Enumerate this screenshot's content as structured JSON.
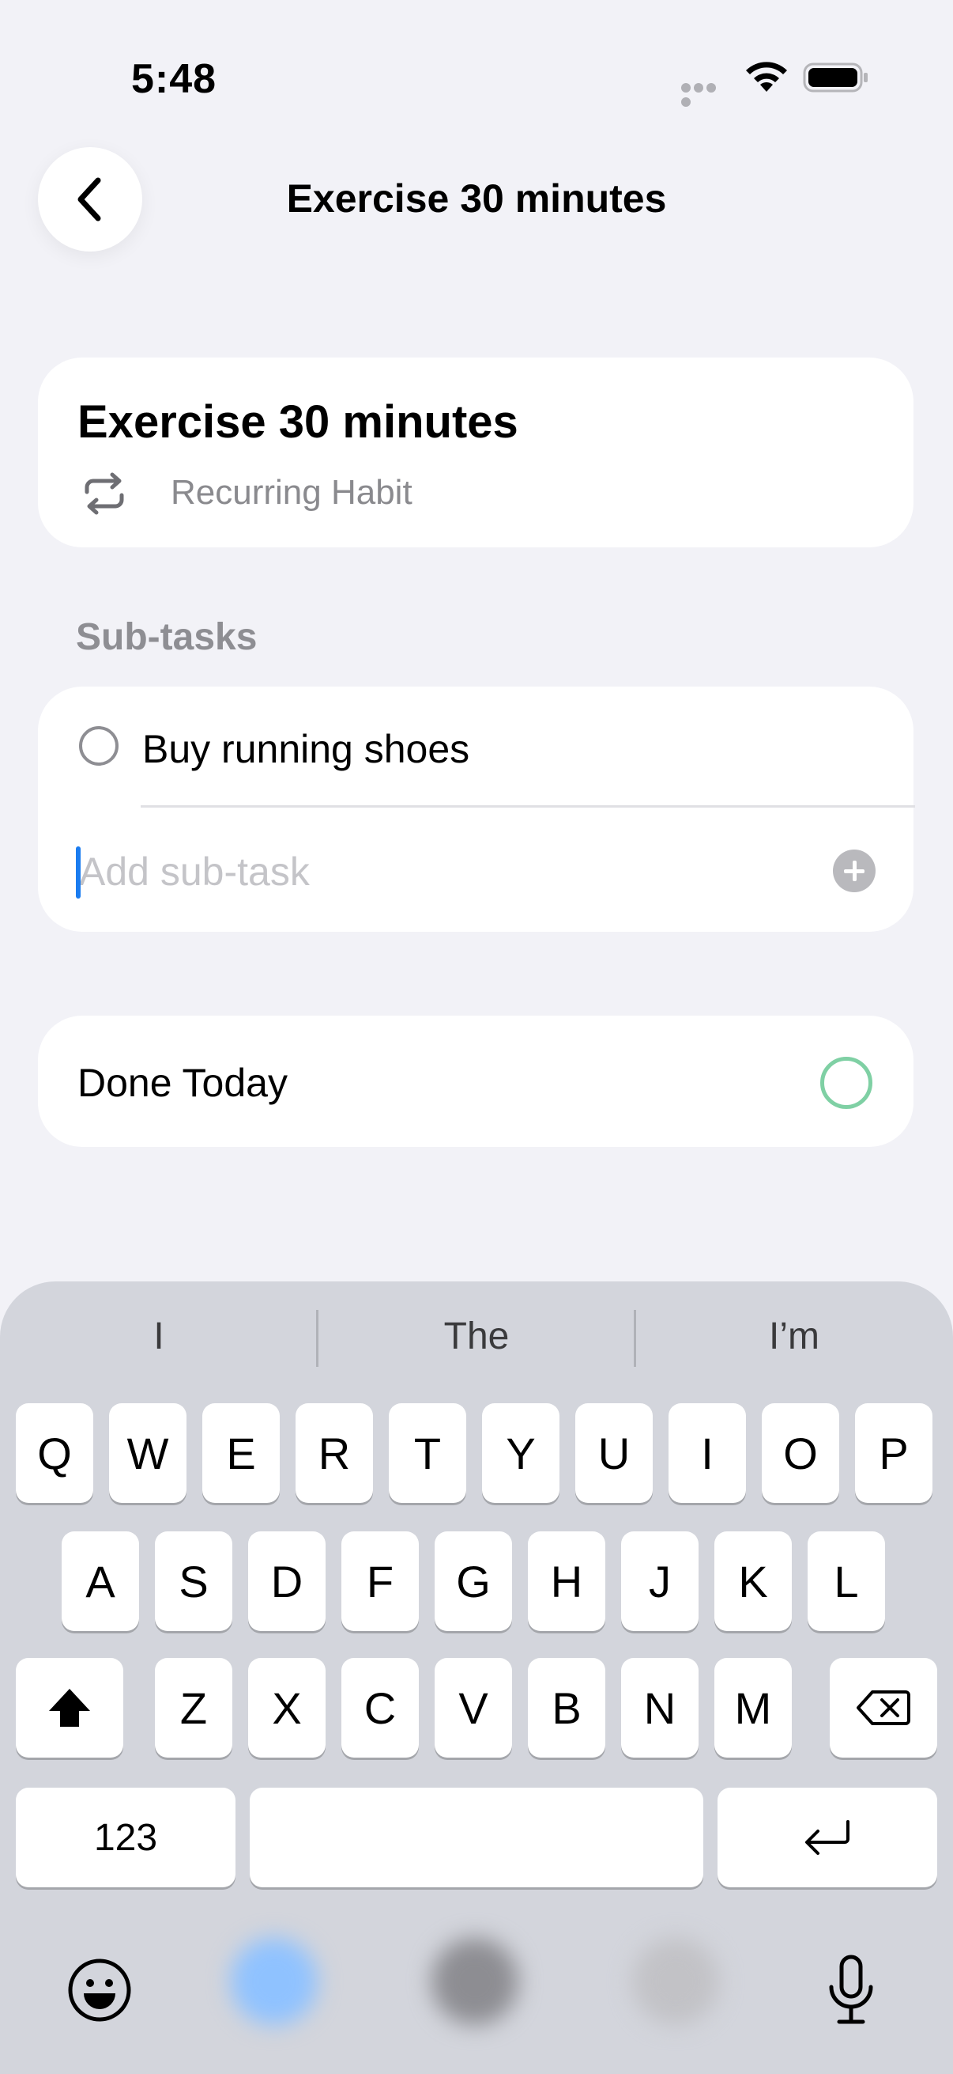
{
  "status_bar": {
    "time": "5:48",
    "icons": [
      "signal-dots-icon",
      "wifi-icon",
      "battery-icon"
    ]
  },
  "nav": {
    "back_icon": "chevron-left-icon",
    "title": "Exercise 30 minutes"
  },
  "habit": {
    "title": "Exercise 30 minutes",
    "type_icon": "repeat-icon",
    "type_label": "Recurring Habit"
  },
  "subtasks": {
    "header": "Sub-tasks",
    "items": [
      {
        "label": "Buy running shoes",
        "done": false
      }
    ],
    "add_placeholder": "Add sub-task",
    "add_value": "",
    "add_icon": "plus-circle-icon"
  },
  "done_today": {
    "label": "Done Today",
    "checked": false
  },
  "keyboard": {
    "suggestions": [
      "I",
      "The",
      "I’m"
    ],
    "rows": [
      [
        "Q",
        "W",
        "E",
        "R",
        "T",
        "Y",
        "U",
        "I",
        "O",
        "P"
      ],
      [
        "A",
        "S",
        "D",
        "F",
        "G",
        "H",
        "J",
        "K",
        "L"
      ],
      [
        "Z",
        "X",
        "C",
        "V",
        "B",
        "N",
        "M"
      ]
    ],
    "numbers_label": "123",
    "shift_icon": "shift-icon",
    "delete_icon": "backspace-icon",
    "return_icon": "return-icon",
    "emoji_icon": "emoji-icon",
    "mic_icon": "microphone-icon"
  },
  "colors": {
    "background": "#f2f2f7",
    "card": "#ffffff",
    "accent_caret": "#1a7cf0",
    "done_ring": "#7fd0a4",
    "secondary_text": "#8e8e93"
  }
}
